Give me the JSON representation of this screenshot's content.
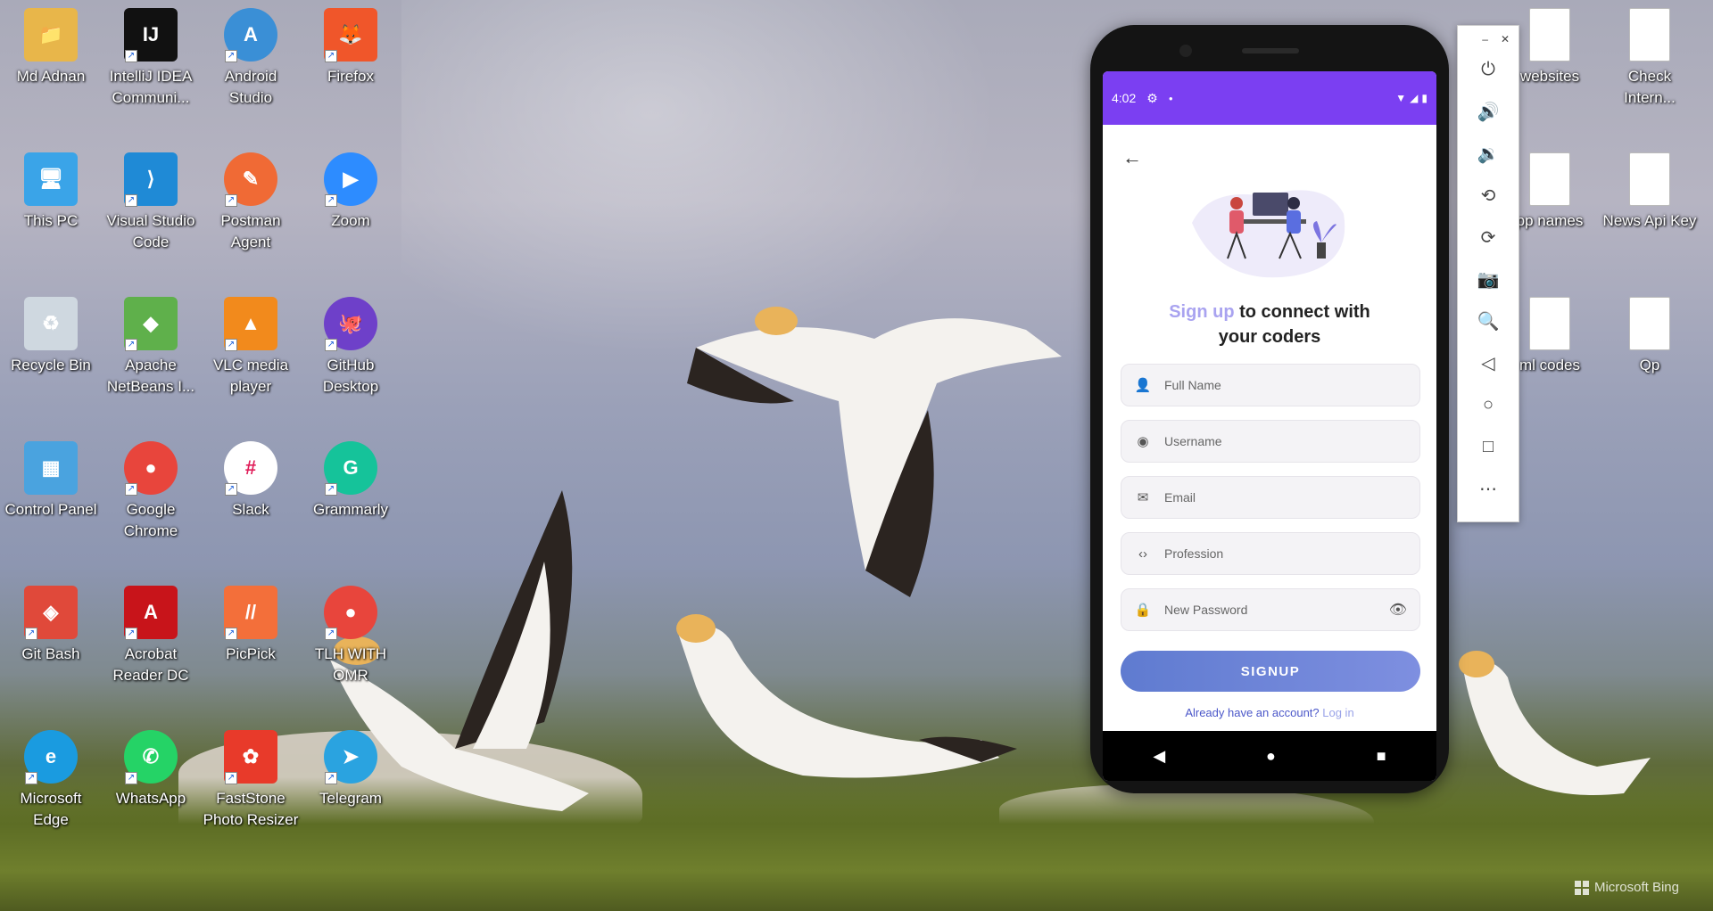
{
  "desktop": {
    "icons": [
      {
        "label": "Md Adnan",
        "icon": "user-folder-icon",
        "color": "#e8b64a",
        "glyph": "📁"
      },
      {
        "label": "IntelliJ IDEA\nCommuni...",
        "icon": "intellij-icon",
        "color": "#111111",
        "glyph": "IJ"
      },
      {
        "label": "Android\nStudio",
        "icon": "android-studio-icon",
        "color": "#3a8fd6",
        "glyph": "A"
      },
      {
        "label": "Firefox",
        "icon": "firefox-icon",
        "color": "#f0562a",
        "glyph": "🦊"
      },
      {
        "label": "This PC",
        "icon": "this-pc-icon",
        "color": "#3aa4e8",
        "glyph": "🖥"
      },
      {
        "label": "Visual Studio\nCode",
        "icon": "vscode-icon",
        "color": "#1f8ad6",
        "glyph": "⟩"
      },
      {
        "label": "Postman\nAgent",
        "icon": "postman-icon",
        "color": "#f06a35",
        "glyph": "✎"
      },
      {
        "label": "Zoom",
        "icon": "zoom-icon",
        "color": "#2d8cff",
        "glyph": "▶"
      },
      {
        "label": "Recycle Bin",
        "icon": "recycle-bin-icon",
        "color": "#cfd8e0",
        "glyph": "♻"
      },
      {
        "label": "Apache\nNetBeans I...",
        "icon": "netbeans-icon",
        "color": "#5fb04b",
        "glyph": "◆"
      },
      {
        "label": "VLC media\nplayer",
        "icon": "vlc-icon",
        "color": "#f28a1c",
        "glyph": "▲"
      },
      {
        "label": "GitHub\nDesktop",
        "icon": "github-desktop-icon",
        "color": "#6e40c9",
        "glyph": "🐙"
      },
      {
        "label": "Control Panel",
        "icon": "control-panel-icon",
        "color": "#4aa3df",
        "glyph": "▦"
      },
      {
        "label": "Google\nChrome",
        "icon": "chrome-icon",
        "color": "#e8453c",
        "glyph": "●"
      },
      {
        "label": "Slack",
        "icon": "slack-icon",
        "color": "#ffffff",
        "glyph": "#"
      },
      {
        "label": "Grammarly",
        "icon": "grammarly-icon",
        "color": "#15c39a",
        "glyph": "G"
      },
      {
        "label": "Git Bash",
        "icon": "git-bash-icon",
        "color": "#e0493a",
        "glyph": "◈"
      },
      {
        "label": "Acrobat\nReader DC",
        "icon": "acrobat-icon",
        "color": "#c8141a",
        "glyph": "A"
      },
      {
        "label": "PicPick",
        "icon": "picpick-icon",
        "color": "#f36f3a",
        "glyph": "//"
      },
      {
        "label": "TLH WITH\nOMR",
        "icon": "chrome-shortcut-icon",
        "color": "#e8453c",
        "glyph": "●"
      },
      {
        "label": "Microsoft\nEdge",
        "icon": "edge-icon",
        "color": "#1a9be0",
        "glyph": "e"
      },
      {
        "label": "WhatsApp",
        "icon": "whatsapp-icon",
        "color": "#25d366",
        "glyph": "✆"
      },
      {
        "label": "FastStone\nPhoto Resizer",
        "icon": "faststone-icon",
        "color": "#e83a2a",
        "glyph": "✿"
      },
      {
        "label": "Telegram",
        "icon": "telegram-icon",
        "color": "#2aa3e0",
        "glyph": "➤"
      },
      {
        "label": "websites",
        "icon": "text-file-icon",
        "color": "#ffffff",
        "glyph": ""
      },
      {
        "label": "Check\nIntern...",
        "icon": "text-file-icon",
        "color": "#ffffff",
        "glyph": ""
      },
      {
        "label": "pp names",
        "icon": "text-file-icon",
        "color": "#ffffff",
        "glyph": ""
      },
      {
        "label": "News Api Key",
        "icon": "text-file-icon",
        "color": "#ffffff",
        "glyph": ""
      },
      {
        "label": "ml codes",
        "icon": "text-file-icon",
        "color": "#ffffff",
        "glyph": ""
      },
      {
        "label": "Qp",
        "icon": "text-file-icon",
        "color": "#ffffff",
        "glyph": ""
      }
    ],
    "watermark": "Microsoft Bing"
  },
  "phone": {
    "status_time": "4:02",
    "status_icons": [
      "settings-icon",
      "dot-icon",
      "wifi-icon",
      "signal-icon",
      "battery-icon"
    ],
    "headline_accent": "Sign up",
    "headline_rest": " to connect with",
    "headline_line2": "your coders",
    "fields": {
      "full_name": {
        "placeholder": "Full Name",
        "value": ""
      },
      "username": {
        "placeholder": "Username",
        "value": ""
      },
      "email": {
        "placeholder": "Email",
        "value": ""
      },
      "profession": {
        "placeholder": "Profession",
        "value": ""
      },
      "password": {
        "placeholder": "New Password",
        "value": ""
      }
    },
    "signup_label": "SIGNUP",
    "login_prompt": "Already have an account? ",
    "login_link": "Log in",
    "accent_color": "#7b3ff2"
  },
  "emulator_toolbar": {
    "tools": [
      "power-icon",
      "volume-up-icon",
      "volume-down-icon",
      "rotate-left-icon",
      "rotate-right-icon",
      "camera-icon",
      "zoom-icon",
      "back-icon",
      "home-icon",
      "overview-icon",
      "more-icon"
    ]
  }
}
